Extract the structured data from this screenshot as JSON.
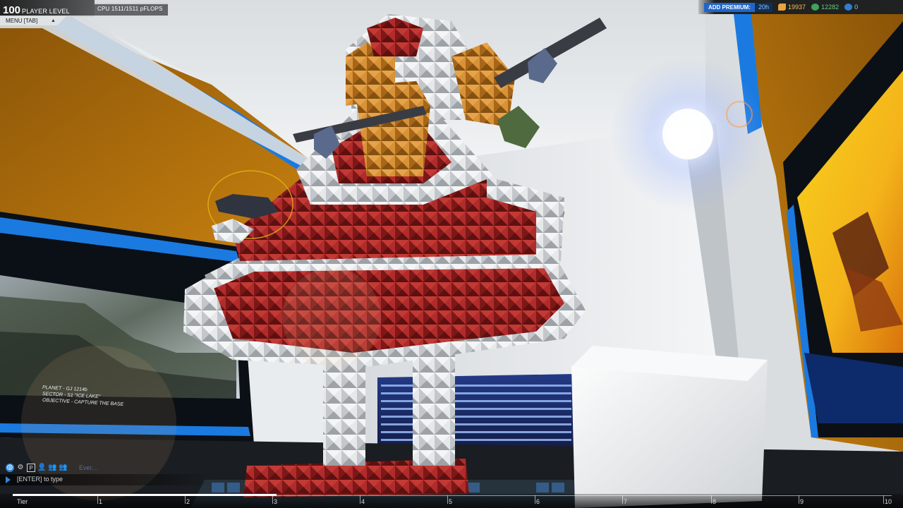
{
  "hud": {
    "level_number": "100",
    "level_label": "PLAYER LEVEL",
    "level_progress": 1.0,
    "cpu_text": "CPU  1511/1511 pFLOPS",
    "cpu_progress": 1.0,
    "menu_label": "MENU [TAB]"
  },
  "top_right": {
    "premium_label": "ADD PREMIUM:",
    "premium_time": "20h",
    "robits": "19937",
    "tech_points": "12282",
    "cosmetic_credits": "0"
  },
  "screen_left": {
    "lines": [
      "PLANET - GJ 1214b",
      "SECTOR - S1 \"ICE LAKE\"",
      "OBJECTIVE - CAPTURE THE BASE"
    ]
  },
  "chat": {
    "input_placeholder": "[ENTER] to type",
    "ghost_text": "Ever..."
  },
  "tier_bar": {
    "label": "Tier",
    "ticks": [
      "1",
      "2",
      "3",
      "4",
      "5",
      "6",
      "7",
      "8",
      "9",
      "10"
    ],
    "progress": 0.3
  },
  "icons": {
    "robits": "robits-icon",
    "tech": "tech-points-icon",
    "cosmetic": "cosmetic-credits-icon",
    "chat": [
      "globe-icon",
      "gear-icon",
      "party-icon",
      "friends-icon",
      "clan-icon",
      "group-icon"
    ]
  },
  "colors": {
    "premium": "#1e66c9",
    "robits": "#f3c057",
    "tech": "#5fd17e",
    "garage_orange": "#c57a10",
    "garage_blue": "#1b7ae0"
  }
}
